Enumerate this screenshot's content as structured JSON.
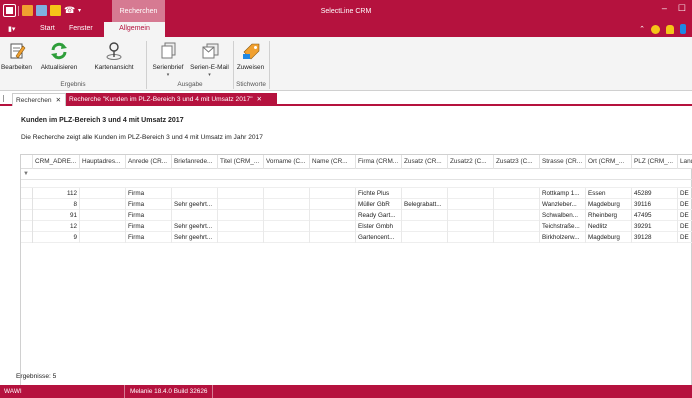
{
  "app": {
    "title": "SelectLine CRM"
  },
  "context_tab": "Recherchen",
  "ribbon_tabs": [
    {
      "label": "Start"
    },
    {
      "label": "Fenster"
    },
    {
      "label": "Allgemein",
      "active": true
    }
  ],
  "ribbon": {
    "buttons": [
      {
        "label": "Bearbeiten",
        "icon": "edit-icon"
      },
      {
        "label": "Aktualisieren",
        "icon": "refresh-icon"
      },
      {
        "label": "Kartenansicht",
        "icon": "map-pin-icon"
      },
      {
        "label": "Serienbrief",
        "icon": "serial-letter-icon"
      },
      {
        "label": "Serien-E-Mail",
        "icon": "serial-email-icon"
      },
      {
        "label": "Zuweisen",
        "icon": "assign-icon"
      }
    ],
    "groups": [
      "Ergebnis",
      "Ausgabe",
      "Stichworte"
    ]
  },
  "doc_tabs": [
    {
      "label": "Recherchen"
    },
    {
      "label": "Recherche \"Kunden im PLZ-Bereich 3 und 4 mit Umsatz 2017\"",
      "active": true
    }
  ],
  "report": {
    "title": "Kunden im PLZ-Bereich 3 und 4 mit Umsatz 2017",
    "description": "Die Recherche zeigt alle Kunden im PLZ-Bereich 3 und 4 mit Umsatz im Jahr 2017"
  },
  "grid": {
    "columns": [
      "CRM_ADRE...",
      "Hauptadres...",
      "Anrede (CR...",
      "Briefanrede...",
      "Titel (CRM_...",
      "Vorname (C...",
      "Name (CR...",
      "Firma (CRM...",
      "Zusatz (CR...",
      "Zusatz2 (C...",
      "Zusatz3 (C...",
      "Strasse (CR...",
      "Ort (CRM_...",
      "PLZ (CRM_...",
      "Land"
    ],
    "rows": [
      [
        "112",
        "",
        "Firma",
        "",
        "",
        "",
        "",
        "Fichte Plus",
        "",
        "",
        "",
        "Rottkamp 1...",
        "Essen",
        "45289",
        "DE"
      ],
      [
        "8",
        "",
        "Firma",
        "Sehr geehrt...",
        "",
        "",
        "",
        "Müller GbR",
        "Belegrabatt...",
        "",
        "",
        "Wanzleber...",
        "Magdeburg",
        "39116",
        "DE"
      ],
      [
        "91",
        "",
        "Firma",
        "",
        "",
        "",
        "",
        "Ready Gart...",
        "",
        "",
        "",
        "Schwalben...",
        "Rheinberg",
        "47495",
        "DE"
      ],
      [
        "12",
        "",
        "Firma",
        "Sehr geehrt...",
        "",
        "",
        "",
        "Elster Gmbh",
        "",
        "",
        "",
        "Teichstraße...",
        "Nedlitz",
        "39291",
        "DE"
      ],
      [
        "9",
        "",
        "Firma",
        "Sehr geehrt...",
        "",
        "",
        "",
        "Gartencent...",
        "",
        "",
        "",
        "Birkholzerw...",
        "Magdeburg",
        "39128",
        "DE"
      ]
    ]
  },
  "results_label": "Ergebnisse: 5",
  "status": {
    "left": "WAWI",
    "user_build": "Melanie  18.4.0 Build 32626"
  },
  "colors": {
    "brand": "#b5123e",
    "context_tab": "#d67a92"
  }
}
